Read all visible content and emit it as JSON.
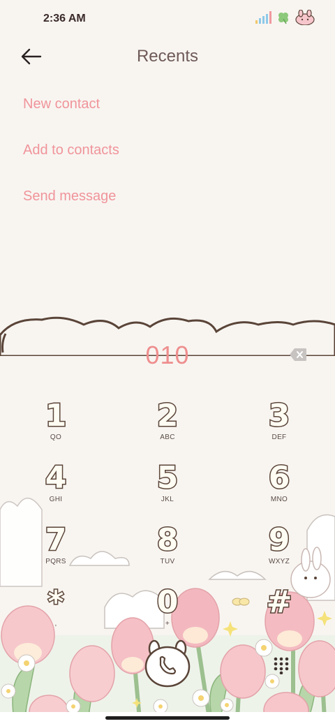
{
  "status_bar": {
    "time": "2:36 AM",
    "icons": [
      "signal-bars-icon",
      "clover-icon",
      "bunny-face-icon"
    ]
  },
  "header": {
    "title": "Recents",
    "back_icon": "arrow-left-icon"
  },
  "menu": {
    "new_contact": "New contact",
    "add_to_contacts": "Add to contacts",
    "send_message": "Send message"
  },
  "dialer": {
    "number": "010",
    "keys": [
      {
        "digit": "1",
        "letters": "QO"
      },
      {
        "digit": "2",
        "letters": "ABC"
      },
      {
        "digit": "3",
        "letters": "DEF"
      },
      {
        "digit": "4",
        "letters": "GHI"
      },
      {
        "digit": "5",
        "letters": "JKL"
      },
      {
        "digit": "6",
        "letters": "MNO"
      },
      {
        "digit": "7",
        "letters": "PQRS"
      },
      {
        "digit": "8",
        "letters": "TUV"
      },
      {
        "digit": "9",
        "letters": "WXYZ"
      },
      {
        "digit": "*",
        "letters": ","
      },
      {
        "digit": "0",
        "letters": "+"
      },
      {
        "digit": "#",
        "letters": ""
      }
    ],
    "icons": {
      "backspace": "backspace-icon",
      "call": "phone-icon",
      "keypad": "keypad-grid-icon"
    }
  },
  "colors": {
    "background": "#f8f5f1",
    "accent": "#f0949a",
    "number": "#ee8e8e",
    "title": "#6e5a57"
  }
}
